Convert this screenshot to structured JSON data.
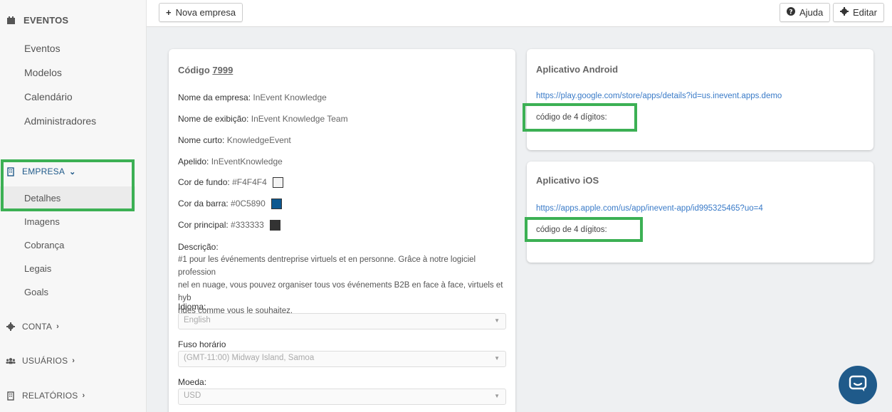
{
  "sidebar": {
    "eventos": {
      "label": "EVENTOS",
      "items": [
        "Eventos",
        "Modelos",
        "Calendário",
        "Administradores"
      ]
    },
    "empresa": {
      "label": "EMPRESA",
      "items": [
        "Detalhes",
        "Imagens",
        "Cobrança",
        "Legais",
        "Goals"
      ]
    },
    "conta": {
      "label": "CONTA"
    },
    "usuarios": {
      "label": "USUÁRIOS"
    },
    "relatorios": {
      "label": "RELATÓRIOS"
    }
  },
  "toolbar": {
    "new_company": "Nova empresa",
    "help": "Ajuda",
    "edit": "Editar"
  },
  "company": {
    "code_label": "Código",
    "code_value": "7999",
    "fields": [
      {
        "label": "Nome da empresa:",
        "value": "InEvent Knowledge"
      },
      {
        "label": "Nome de exibição:",
        "value": "InEvent Knowledge Team"
      },
      {
        "label": "Nome curto:",
        "value": "KnowledgeEvent"
      },
      {
        "label": "Apelido:",
        "value": "InEventKnowledge"
      }
    ],
    "colors": [
      {
        "label": "Cor de fundo:",
        "value": "#F4F4F4",
        "swatch": "#F4F4F4"
      },
      {
        "label": "Cor da barra:",
        "value": "#0C5890",
        "swatch": "#0C5890"
      },
      {
        "label": "Cor principal:",
        "value": "#333333",
        "swatch": "#333333"
      }
    ],
    "description_label": "Descrição:",
    "description_lines": [
      "#1 pour les événements dentreprise virtuels et en personne. Grâce à notre logiciel profession",
      "nel en nuage, vous pouvez organiser tous vos événements B2B en face à face, virtuels et hyb",
      "rides comme vous le souhaitez."
    ],
    "language_label": "Idioma:",
    "language_value": "English",
    "timezone_label": "Fuso horário",
    "timezone_value": "(GMT-11:00) Midway Island, Samoa",
    "currency_label": "Moeda:",
    "currency_value": "USD"
  },
  "android": {
    "title": "Aplicativo Android",
    "link": "https://play.google.com/store/apps/details?id=us.inevent.apps.demo",
    "code": "código de 4 dígitos:"
  },
  "ios": {
    "title": "Aplicativo iOS",
    "link": "https://apps.apple.com/us/app/inevent-app/id995325465?uo=4",
    "code": "código de 4 dígitos:"
  },
  "colors": {
    "highlight": "#3cb054",
    "link": "#3a7bc8",
    "chat": "#1f5a8a"
  }
}
